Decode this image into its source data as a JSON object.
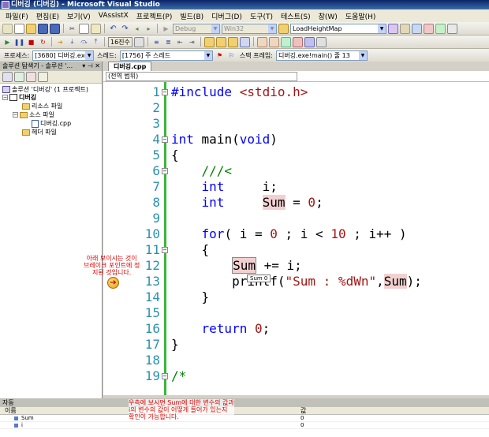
{
  "window": {
    "title": "디버깅 (디버깅) - Microsoft Visual Studio"
  },
  "menu": [
    "파일(F)",
    "편집(E)",
    "보기(V)",
    "VAssistX",
    "프로젝트(P)",
    "빌드(B)",
    "디버그(D)",
    "도구(T)",
    "테스트(S)",
    "창(W)",
    "도움말(H)"
  ],
  "toolbar1": {
    "config": "Debug",
    "platform": "Win32",
    "search": "LoadHeightMap"
  },
  "toolbar2": {
    "hex": "16진수"
  },
  "toolbar3": {
    "process_label": "프로세스:",
    "process_value": "[3680] 디버깅.exe",
    "thread_label": "스레드:",
    "thread_value": "[1756] 주 스레드",
    "frame_label": "스택 프레임:",
    "frame_value": "디버깅.exe!main()  줄 13"
  },
  "solution_explorer": {
    "title": "솔루션 탐색기 - 솔루션 '...",
    "items": [
      "솔루션 '디버깅' (1 프로젝트)",
      "디버깅",
      "리소스 파일",
      "소스 파일",
      "디버깅.cpp",
      "헤더 파일"
    ]
  },
  "editor": {
    "tab": "디버깅.cpp",
    "scope": "(전역 범위)",
    "line_numbers": [
      "1",
      "2",
      "3",
      "4",
      "5",
      "6",
      "7",
      "8",
      "9",
      "10",
      "11",
      "12",
      "13",
      "14",
      "15",
      "16",
      "17",
      "18",
      "19"
    ],
    "datatip": "Sum  0"
  },
  "annotations": {
    "breakpoint_note": "아래 보이시는 것이\n브레이크 포인트에 정\n지된 것입니다.",
    "auto_note": "우측에 보시면 Sum에 대한 변수의 값과\ni의 변수의 값이 어떻게 들어가 있는지\n확인이 가능합니다."
  },
  "autos": {
    "title": "자동",
    "col_name": "이름",
    "col_value": "값",
    "rows": [
      {
        "name": "Sum",
        "value": "0"
      },
      {
        "name": "i",
        "value": "0"
      }
    ]
  },
  "colors": {
    "keyword": "#0000ff",
    "string": "#a31515",
    "comment": "#008000",
    "line_number": "#2b91af",
    "annotation": "#e00000"
  }
}
